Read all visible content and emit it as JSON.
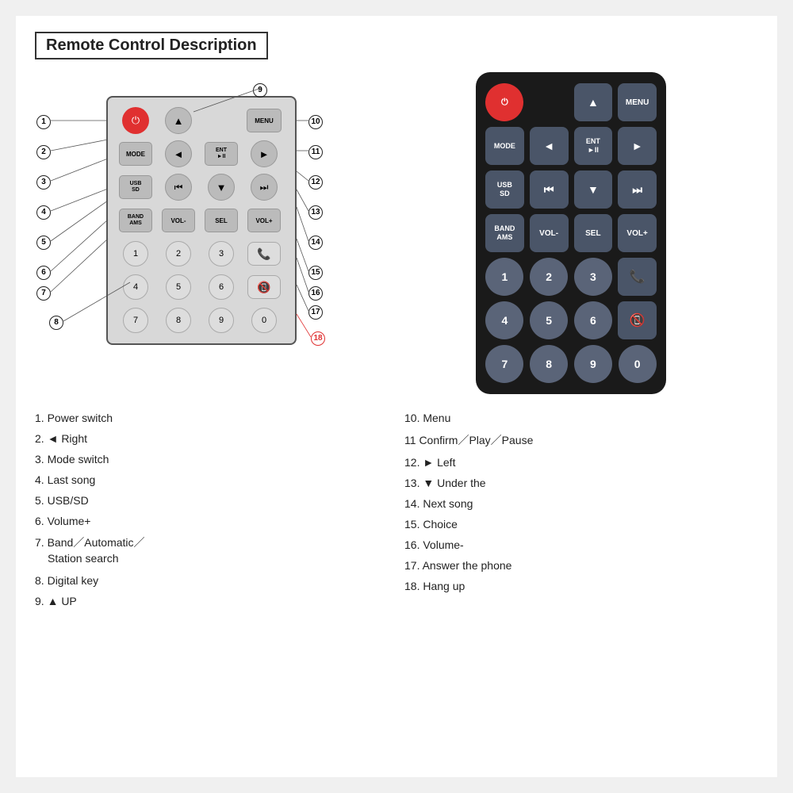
{
  "page": {
    "title": "Remote Control Description"
  },
  "diagram": {
    "buttons": [
      {
        "id": "power",
        "label": "⏻",
        "type": "power"
      },
      {
        "id": "arrow-up",
        "label": "▲",
        "type": "arrow"
      },
      {
        "id": "menu",
        "label": "MENU",
        "type": "text"
      },
      {
        "id": "mode",
        "label": "MODE",
        "type": "text"
      },
      {
        "id": "arrow-left",
        "label": "◄",
        "type": "arrow"
      },
      {
        "id": "ent",
        "label": "ENT\n►II",
        "type": "text"
      },
      {
        "id": "arrow-right2",
        "label": "►",
        "type": "arrow"
      },
      {
        "id": "usb",
        "label": "USB\nSD",
        "type": "text"
      },
      {
        "id": "prev",
        "label": "⏮",
        "type": "arrow"
      },
      {
        "id": "arrow-down",
        "label": "▼",
        "type": "arrow"
      },
      {
        "id": "next",
        "label": "⏭",
        "type": "arrow"
      },
      {
        "id": "band",
        "label": "BAND\nAMS",
        "type": "text"
      },
      {
        "id": "vol-",
        "label": "VOL-",
        "type": "text"
      },
      {
        "id": "sel",
        "label": "SEL",
        "type": "text"
      },
      {
        "id": "vol+",
        "label": "VOL+",
        "type": "text"
      },
      {
        "id": "n1",
        "label": "1",
        "type": "num"
      },
      {
        "id": "n2",
        "label": "2",
        "type": "num"
      },
      {
        "id": "n3",
        "label": "3",
        "type": "num"
      },
      {
        "id": "call-green",
        "label": "📞",
        "type": "green"
      },
      {
        "id": "n4",
        "label": "4",
        "type": "num"
      },
      {
        "id": "n5",
        "label": "5",
        "type": "num"
      },
      {
        "id": "n6",
        "label": "6",
        "type": "num"
      },
      {
        "id": "call-red",
        "label": "📵",
        "type": "red"
      },
      {
        "id": "n7",
        "label": "7",
        "type": "num"
      },
      {
        "id": "n8",
        "label": "8",
        "type": "num"
      },
      {
        "id": "n9",
        "label": "9",
        "type": "num"
      },
      {
        "id": "n0",
        "label": "0",
        "type": "num"
      }
    ]
  },
  "descriptions": {
    "left": [
      {
        "num": "1",
        "text": "Power switch"
      },
      {
        "num": "2",
        "text": "◄ Right"
      },
      {
        "num": "3",
        "text": "Mode switch"
      },
      {
        "num": "4",
        "text": "Last song"
      },
      {
        "num": "5",
        "text": "USB/SD"
      },
      {
        "num": "6",
        "text": "Volume+"
      },
      {
        "num": "7",
        "text": "Band／Automatic／\n    Station search"
      },
      {
        "num": "8",
        "text": "Digital key"
      },
      {
        "num": "9",
        "text": "▲ UP"
      }
    ],
    "right": [
      {
        "num": "10",
        "text": "Menu"
      },
      {
        "num": "11",
        "text": "Confirm／Play／Pause"
      },
      {
        "num": "12",
        "text": "► Left"
      },
      {
        "num": "13",
        "text": "▼ Under the"
      },
      {
        "num": "14",
        "text": "Next song"
      },
      {
        "num": "15",
        "text": "Choice"
      },
      {
        "num": "16",
        "text": "Volume-"
      },
      {
        "num": "17",
        "text": "Answer the phone"
      },
      {
        "num": "18",
        "text": "Hang up"
      }
    ]
  }
}
